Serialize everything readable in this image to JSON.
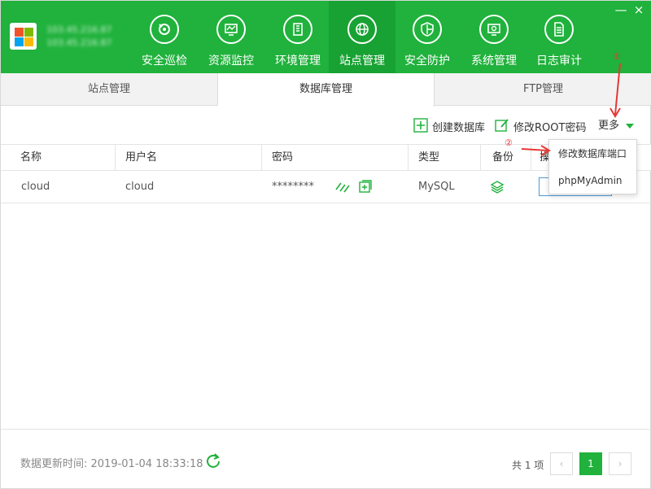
{
  "header": {
    "server_info": [
      "103.45.216.87",
      "103.45.216.87"
    ],
    "nav": [
      {
        "label": "安全巡检",
        "icon": "shield-scan-icon"
      },
      {
        "label": "资源监控",
        "icon": "monitor-icon"
      },
      {
        "label": "环境管理",
        "icon": "building-icon"
      },
      {
        "label": "站点管理",
        "icon": "globe-icon"
      },
      {
        "label": "安全防护",
        "icon": "shield-icon"
      },
      {
        "label": "系统管理",
        "icon": "gear-monitor-icon"
      },
      {
        "label": "日志审计",
        "icon": "document-icon"
      }
    ],
    "active_nav": "站点管理",
    "window_buttons": {
      "minimize": "—",
      "close": "×"
    }
  },
  "tabs": [
    {
      "label": "站点管理"
    },
    {
      "label": "数据库管理"
    },
    {
      "label": "FTP管理"
    }
  ],
  "active_tab": "数据库管理",
  "toolbar": {
    "create_db": "创建数据库",
    "change_root_pwd": "修改ROOT密码",
    "more": "更多"
  },
  "table": {
    "headers": [
      "名称",
      "用户名",
      "密码",
      "类型",
      "备份",
      "操"
    ],
    "rows": [
      {
        "name": "cloud",
        "username": "cloud",
        "password": "********",
        "type": "MySQL"
      }
    ]
  },
  "dropdown": {
    "items": [
      "修改数据库端口",
      "phpMyAdmin"
    ]
  },
  "annotations": {
    "step1": "①",
    "step2": "②"
  },
  "footer": {
    "update_label": "数据更新时间: 2019-01-04 18:33:18",
    "total": "共 1 项",
    "current_page": "1",
    "prev": "‹",
    "next": "›"
  },
  "colors": {
    "brand_green": "#20b23c",
    "active_nav": "#18a233",
    "annotation_red": "#e53935"
  }
}
